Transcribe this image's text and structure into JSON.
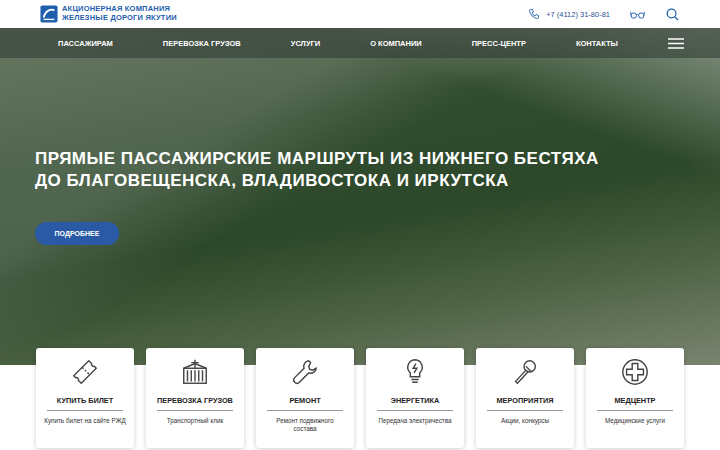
{
  "header": {
    "logo": {
      "line1": "АКЦИОНЕРНАЯ КОМПАНИЯ",
      "line2": "ЖЕЛЕЗНЫЕ ДОРОГИ ЯКУТИИ"
    },
    "phone": "+7 (4112) 31-80-81"
  },
  "nav": {
    "items": [
      "ПАССАЖИРАМ",
      "ПЕРЕВОЗКА ГРУЗОВ",
      "УСЛУГИ",
      "О КОМПАНИИ",
      "ПРЕСС-ЦЕНТР",
      "КОНТАКТЫ"
    ]
  },
  "hero": {
    "title_lines": [
      "ПРЯМЫЕ ПАССАЖИРСКИЕ МАРШРУТЫ ИЗ НИЖНЕГО БЕСТЯХА",
      "ДО БЛАГОВЕЩЕНСКА, ВЛАДИВОСТОКА И ИРКУТСКА"
    ],
    "button": "ПОДРОБНЕЕ"
  },
  "cards": [
    {
      "title": "КУПИТЬ БИЛЕТ",
      "subtitle": "Купить билет на сайте РЖД"
    },
    {
      "title": "ПЕРЕВОЗКА ГРУЗОВ",
      "subtitle": "Транспортный клик"
    },
    {
      "title": "РЕМОНТ",
      "subtitle": "Ремонт подвижного состава"
    },
    {
      "title": "ЭНЕРГЕТИКА",
      "subtitle": "Передача электричества"
    },
    {
      "title": "МЕРОПРИЯТИЯ",
      "subtitle": "Акции, конкурсы"
    },
    {
      "title": "МЕДЦЕНТР",
      "subtitle": "Медицинские услуги"
    }
  ]
}
